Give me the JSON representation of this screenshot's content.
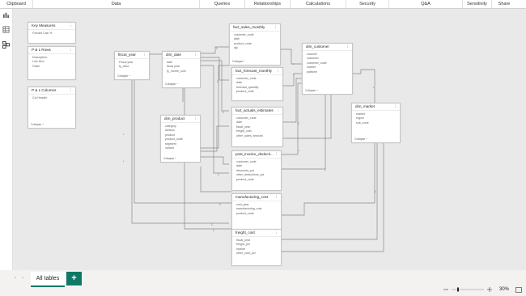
{
  "ribbon": [
    {
      "label": "Clipboard"
    },
    {
      "label": "Data"
    },
    {
      "label": "Queries"
    },
    {
      "label": "Relationships"
    },
    {
      "label": "Calculations"
    },
    {
      "label": "Security"
    },
    {
      "label": "Q&A"
    },
    {
      "label": "Sensitivity"
    },
    {
      "label": "Share"
    }
  ],
  "left_rail": [
    "report-view-icon",
    "table-view-icon",
    "model-view-icon"
  ],
  "collapse_label": "Collapse ^",
  "tables": {
    "key_measures": {
      "title": "Key Measures",
      "rows": [
        "Forcast Calc %"
      ]
    },
    "pl_rows": {
      "title": "P & L Rows",
      "rows": [
        "Description",
        "Line item",
        "Order"
      ]
    },
    "pl_columns": {
      "title": "P & L Columns",
      "rows": [
        "Col Header"
      ]
    },
    "fiscal_year": {
      "title": "fiscal_year",
      "rows": [
        "Fiscal year",
        "fy_desc"
      ]
    },
    "dim_date": {
      "title": "dim_date",
      "rows": [
        "date",
        "fiscal year",
        "fy_month_num"
      ]
    },
    "fact_sales_monthly": {
      "title": "fact_sales_monthly",
      "rows": [
        "customer_code",
        "date",
        "product_code",
        "qty"
      ]
    },
    "fact_forecast_monthly": {
      "title": "fact_forecast_monthly",
      "rows": [
        "customer_code",
        "date",
        "forecast_quantity",
        "product_code"
      ]
    },
    "fact_actuals_estimates": {
      "title": "fact_actuals_estimates",
      "rows": [
        "customer_code",
        "date",
        "fiscal_year",
        "freight_cost",
        "other_sales_amount"
      ]
    },
    "dim_customer": {
      "title": "dim_customer",
      "rows": [
        "channel",
        "customer",
        "customer_code",
        "market",
        "platform"
      ]
    },
    "dim_market": {
      "title": "dim_market",
      "rows": [
        "market",
        "region",
        "sub_zone"
      ]
    },
    "dim_product": {
      "title": "dim_product",
      "rows": [
        "category",
        "division",
        "product",
        "product_code",
        "segment",
        "variant"
      ]
    },
    "post_invoice": {
      "title": "post_invoice_deducti...",
      "rows": [
        "customer_code",
        "date",
        "discounts_pct",
        "other_deductions_pct",
        "product_code"
      ]
    },
    "manufacturing_cost": {
      "title": "manufacturing_cost",
      "rows": [
        "cost_year",
        "manufacturing_cost",
        "product_code"
      ]
    },
    "freight_cost": {
      "title": "freight_cost",
      "rows": [
        "fiscal_year",
        "freight_pct",
        "market",
        "other_cost_pct"
      ]
    }
  },
  "bottom": {
    "tab_label": "All tables",
    "add_label": "+",
    "zoom": "30%"
  },
  "colors": {
    "accent": "#117865",
    "canvas": "#e9e9e9",
    "line": "#8a8886"
  }
}
